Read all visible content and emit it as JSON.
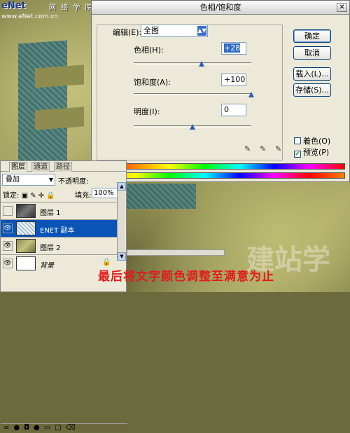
{
  "site": {
    "logo": "eNet",
    "logo_cn": "网 络 学 院",
    "url": "www.eNet.com.cn"
  },
  "dialog": {
    "title": "色相/饱和度",
    "edit_label": "编辑(E):",
    "edit_value": "全图",
    "hue_label": "色相(H):",
    "hue_value": "+28",
    "hue_level": 0.578,
    "saturation_label": "饱和度(A):",
    "saturation_value": "+100",
    "saturation_level": 1.0,
    "lightness_label": "明度(I):",
    "lightness_value": "0",
    "lightness_level": 0.5,
    "buttons": {
      "ok": "确定",
      "cancel": "取消",
      "load": "载入(L)...",
      "save": "存储(S)..."
    },
    "colorize_label": "着色(O)",
    "colorize_checked": false,
    "preview_label": "预览(P)",
    "preview_checked": true
  },
  "layers_panel": {
    "tabs": [
      "图层",
      "通道",
      "路径"
    ],
    "blend_mode": "叠加",
    "opacity_label": "不透明度:",
    "lock_label": "锁定:",
    "fill_label": "填充:",
    "fill_value": "100%",
    "layers": [
      {
        "name": "图层 1",
        "visible": false,
        "selected": false,
        "locked": false
      },
      {
        "name": "ENET 副本",
        "visible": true,
        "selected": true,
        "locked": false
      },
      {
        "name": "图层 2",
        "visible": true,
        "selected": false,
        "locked": false
      },
      {
        "name": "背景",
        "visible": true,
        "selected": false,
        "locked": true
      }
    ]
  },
  "caption": "最后将文字颜色调整至满意为止",
  "watermark": "建站学"
}
